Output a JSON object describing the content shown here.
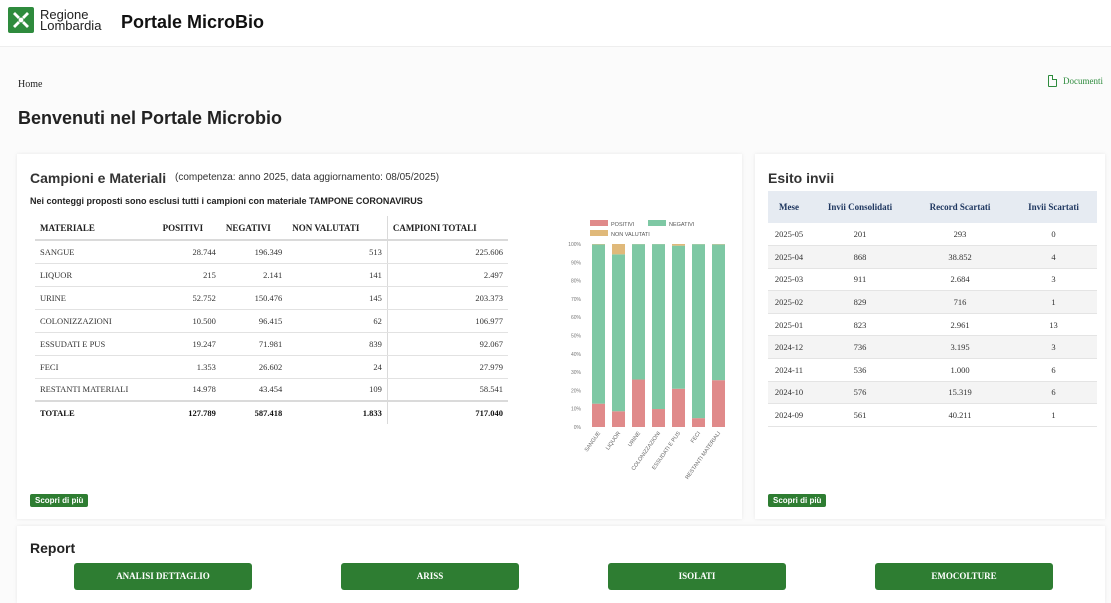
{
  "header": {
    "logo_line1": "Regione",
    "logo_line2": "Lombardia",
    "portal_title": "Portale MicroBio"
  },
  "breadcrumb": "Home",
  "documents_link": "Documenti",
  "page_title": "Benvenuti nel Portale Microbio",
  "campioni": {
    "title": "Campioni e Materiali",
    "subtitle": "(competenza: anno 2025, data aggiornamento: 08/05/2025)",
    "note": "Nei conteggi proposti sono esclusi tutti i campioni con materiale TAMPONE CORONAVIRUS",
    "columns": [
      "MATERIALE",
      "POSITIVI",
      "NEGATIVI",
      "NON VALUTATI",
      "CAMPIONI TOTALI"
    ],
    "rows": [
      [
        "SANGUE",
        "28.744",
        "196.349",
        "513",
        "225.606"
      ],
      [
        "LIQUOR",
        "215",
        "2.141",
        "141",
        "2.497"
      ],
      [
        "URINE",
        "52.752",
        "150.476",
        "145",
        "203.373"
      ],
      [
        "COLONIZZAZIONI",
        "10.500",
        "96.415",
        "62",
        "106.977"
      ],
      [
        "ESSUDATI E PUS",
        "19.247",
        "71.981",
        "839",
        "92.067"
      ],
      [
        "FECI",
        "1.353",
        "26.602",
        "24",
        "27.979"
      ],
      [
        "RESTANTI MATERIALI",
        "14.978",
        "43.454",
        "109",
        "58.541"
      ]
    ],
    "total": [
      "TOTALE",
      "127.789",
      "587.418",
      "1.833",
      "717.040"
    ],
    "more_button": "Scopri di più"
  },
  "chart_data": {
    "type": "bar",
    "stacked": true,
    "normalized_percent": true,
    "categories": [
      "SANGUE",
      "LIQUOR",
      "URINE",
      "COLONIZZAZIONI",
      "ESSUDATI E PUS",
      "FECI",
      "RESTANTI MATERIALI"
    ],
    "series": [
      {
        "name": "POSITIVI",
        "color": "#e08a8a",
        "values": [
          28744,
          215,
          52752,
          10500,
          19247,
          1353,
          14978
        ]
      },
      {
        "name": "NEGATIVI",
        "color": "#7ec8a4",
        "values": [
          196349,
          2141,
          150476,
          96415,
          71981,
          26602,
          43454
        ]
      },
      {
        "name": "NON VALUTATI",
        "color": "#e0b97a",
        "values": [
          513,
          141,
          145,
          62,
          839,
          24,
          109
        ]
      }
    ],
    "yticks": [
      "0%",
      "10%",
      "20%",
      "30%",
      "40%",
      "50%",
      "60%",
      "70%",
      "80%",
      "90%",
      "100%"
    ],
    "ylim": [
      0,
      100
    ],
    "legend": "top"
  },
  "esito": {
    "title": "Esito invii",
    "columns": [
      "Mese",
      "Invii Consolidati",
      "Record Scartati",
      "Invii Scartati"
    ],
    "rows": [
      [
        "2025-05",
        "201",
        "293",
        "0"
      ],
      [
        "2025-04",
        "868",
        "38.852",
        "4"
      ],
      [
        "2025-03",
        "911",
        "2.684",
        "3"
      ],
      [
        "2025-02",
        "829",
        "716",
        "1"
      ],
      [
        "2025-01",
        "823",
        "2.961",
        "13"
      ],
      [
        "2024-12",
        "736",
        "3.195",
        "3"
      ],
      [
        "2024-11",
        "536",
        "1.000",
        "6"
      ],
      [
        "2024-10",
        "576",
        "15.319",
        "6"
      ],
      [
        "2024-09",
        "561",
        "40.211",
        "1"
      ]
    ],
    "more_button": "Scopri di più"
  },
  "report": {
    "title": "Report",
    "buttons": [
      "ANALISI DETTAGLIO",
      "ARISS",
      "ISOLATI",
      "EMOCOLTURE"
    ]
  },
  "colors": {
    "brand_green": "#2e7d32",
    "table_header_bg": "#e6ebf2"
  }
}
